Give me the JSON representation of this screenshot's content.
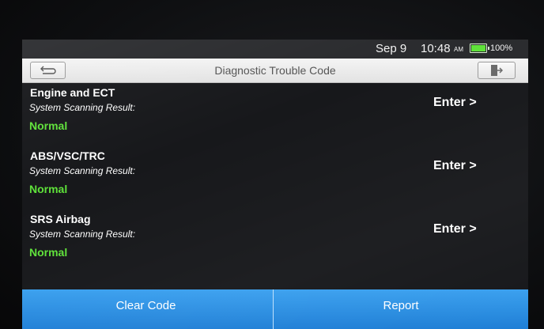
{
  "status_bar": {
    "date": "Sep 9",
    "time": "10:48",
    "ampm": "AM",
    "battery_text": "100%",
    "battery_level": 1.0,
    "battery_color": "#5fe23a"
  },
  "title_bar": {
    "title": "Diagnostic Trouble Code",
    "back_icon": "back-arrow-icon",
    "exit_icon": "exit-icon"
  },
  "systems": [
    {
      "name": "Engine and ECT",
      "subtitle": "System Scanning Result:",
      "result": "Normal",
      "action": "Enter >"
    },
    {
      "name": "ABS/VSC/TRC",
      "subtitle": "System Scanning Result:",
      "result": "Normal",
      "action": "Enter >"
    },
    {
      "name": "SRS Airbag",
      "subtitle": "System Scanning Result:",
      "result": "Normal",
      "action": "Enter >"
    }
  ],
  "bottom_bar": {
    "clear_label": "Clear Code",
    "report_label": "Report"
  },
  "colors": {
    "accent": "#2a8fe6",
    "status_ok": "#5fe23a"
  }
}
